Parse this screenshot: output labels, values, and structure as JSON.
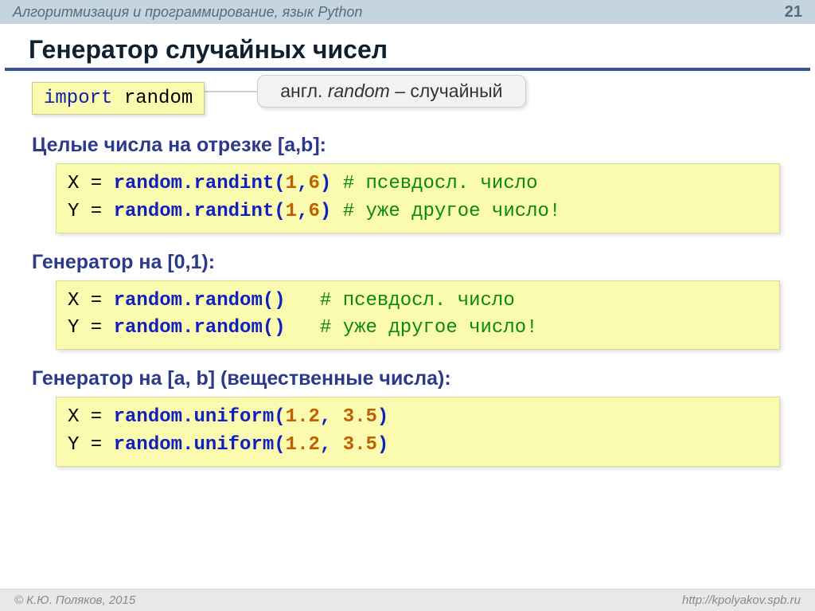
{
  "header": {
    "course_title": "Алгоритмизация и программирование, язык Python",
    "page_number": "21"
  },
  "title": "Генератор случайных чисел",
  "import_stmt": {
    "keyword": "import",
    "module": "random"
  },
  "callout": {
    "prefix": "англ. ",
    "word": "random",
    "suffix": " – случайный"
  },
  "sections": [
    {
      "heading": "Целые числа на отрезке [a,b]:",
      "lines": [
        {
          "lhs": "X",
          "call": "random.randint",
          "open": "(",
          "args": [
            {
              "n": "1"
            },
            {
              "sep": ","
            },
            {
              "n": "6"
            }
          ],
          "close": ")",
          "pad": " ",
          "comment": "# псевдосл. число"
        },
        {
          "lhs": "Y",
          "call": "random.randint",
          "open": "(",
          "args": [
            {
              "n": "1"
            },
            {
              "sep": ","
            },
            {
              "n": "6"
            }
          ],
          "close": ")",
          "pad": " ",
          "comment": "# уже другое число!"
        }
      ]
    },
    {
      "heading": "Генератор на [0,1):",
      "lines": [
        {
          "lhs": "X",
          "call": "random.random",
          "open": "(",
          "args": [],
          "close": ")",
          "pad": "   ",
          "comment": "# псевдосл. число"
        },
        {
          "lhs": "Y",
          "call": "random.random",
          "open": "(",
          "args": [],
          "close": ")",
          "pad": "   ",
          "comment": "# уже другое число!"
        }
      ]
    },
    {
      "heading": "Генератор на [a, b] (вещественные числа):",
      "lines": [
        {
          "lhs": "X",
          "call": "random.uniform",
          "open": "(",
          "args": [
            {
              "n": "1.2"
            },
            {
              "sep": ", "
            },
            {
              "n": "3.5"
            }
          ],
          "close": ")",
          "pad": "",
          "comment": ""
        },
        {
          "lhs": "Y",
          "call": "random.uniform",
          "open": "(",
          "args": [
            {
              "n": "1.2"
            },
            {
              "sep": ", "
            },
            {
              "n": "3.5"
            }
          ],
          "close": ")",
          "pad": "",
          "comment": ""
        }
      ]
    }
  ],
  "footer": {
    "copyright": "© К.Ю. Поляков, 2015",
    "url": "http://kpolyakov.spb.ru"
  }
}
